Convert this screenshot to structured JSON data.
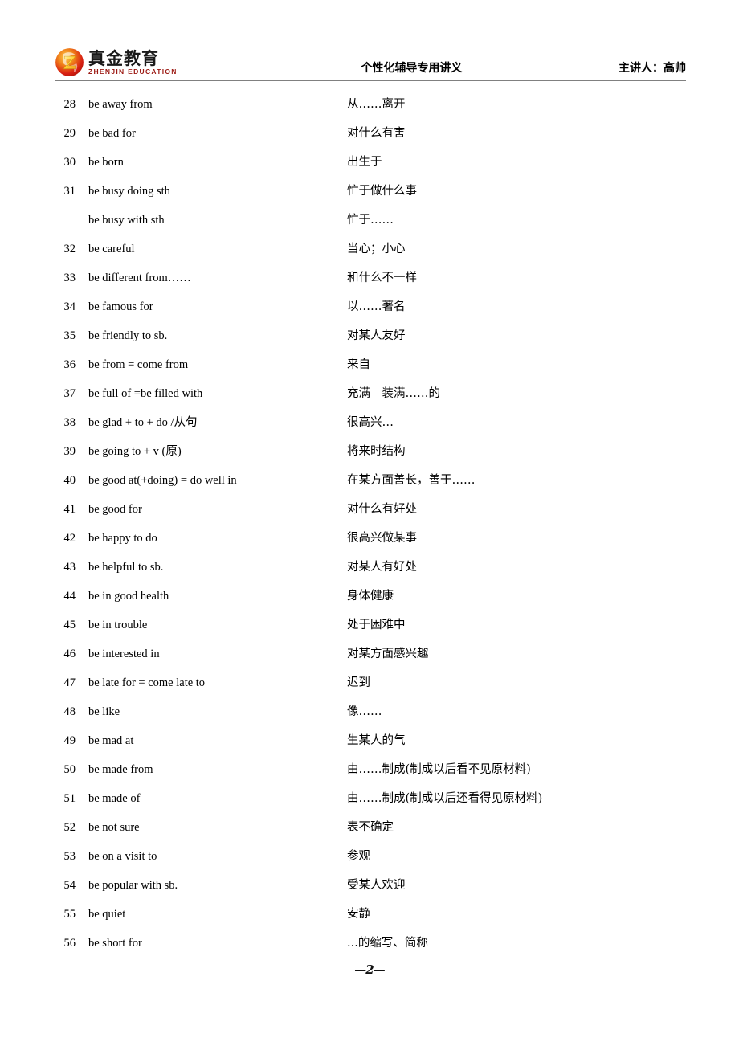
{
  "header": {
    "logo": {
      "mark_name": "zhenjin-logo-mark",
      "chinese": "真金教育",
      "english": "ZHENJIN EDUCATION",
      "colors": {
        "mark_outer": "#d81f13",
        "mark_inner": "#f5a623",
        "english_text": "#9c1a14"
      }
    },
    "title": "个性化辅导专用讲义",
    "presenter": "主讲人：高帅"
  },
  "rows": [
    {
      "num": "28",
      "en": "be away from",
      "cn": "从……离开"
    },
    {
      "num": "29",
      "en": "be bad for",
      "cn": "对什么有害"
    },
    {
      "num": "30",
      "en": "be born",
      "cn": "出生于"
    },
    {
      "num": "31",
      "en": "be busy doing sth",
      "cn": "忙于做什么事"
    },
    {
      "num": "",
      "en": "be busy with sth",
      "cn": "忙于……"
    },
    {
      "num": "32",
      "en": "be careful",
      "cn": "当心；小心"
    },
    {
      "num": "33",
      "en": "be different from……",
      "cn": "和什么不一样"
    },
    {
      "num": "34",
      "en": "be famous for",
      "cn": "以……著名"
    },
    {
      "num": "35",
      "en": "be friendly to sb.",
      "cn": "对某人友好"
    },
    {
      "num": "36",
      "en": "be from = come from",
      "cn": "来自"
    },
    {
      "num": "37",
      "en": "be full of =be filled with",
      "cn": "充满　装满……的"
    },
    {
      "num": "38",
      "en": "be glad + to + do /从句",
      "cn": "很高兴…"
    },
    {
      "num": "39",
      "en": "be going to + v (原)",
      "cn": "将来时结构"
    },
    {
      "num": "40",
      "en": "be good at(+doing) = do well in",
      "cn": "在某方面善长，善于……"
    },
    {
      "num": "41",
      "en": "be good for",
      "cn": "对什么有好处"
    },
    {
      "num": "42",
      "en": "be happy to do",
      "cn": "很高兴做某事"
    },
    {
      "num": "43",
      "en": "be helpful to sb.",
      "cn": "对某人有好处"
    },
    {
      "num": "44",
      "en": "be in good health",
      "cn": "身体健康"
    },
    {
      "num": "45",
      "en": "be in trouble",
      "cn": "处于困难中"
    },
    {
      "num": "46",
      "en": "be interested in",
      "cn": "对某方面感兴趣"
    },
    {
      "num": "47",
      "en": "be late for = come late to",
      "cn": "迟到"
    },
    {
      "num": "48",
      "en": "be like",
      "cn": "像……"
    },
    {
      "num": "49",
      "en": "be mad at",
      "cn": "生某人的气"
    },
    {
      "num": "50",
      "en": "be made from",
      "cn": "由……制成(制成以后看不见原材料)"
    },
    {
      "num": "51",
      "en": "be made of",
      "cn": "由……制成(制成以后还看得见原材料)"
    },
    {
      "num": "52",
      "en": "be not sure",
      "cn": "表不确定"
    },
    {
      "num": "53",
      "en": "be on a visit to",
      "cn": "参观"
    },
    {
      "num": "54",
      "en": "be popular with sb.",
      "cn": "受某人欢迎"
    },
    {
      "num": "55",
      "en": "be quiet",
      "cn": "安静"
    },
    {
      "num": "56",
      "en": "be short for",
      "cn": "...的缩写、简称"
    }
  ],
  "footer": {
    "page_marker": "—2—"
  }
}
